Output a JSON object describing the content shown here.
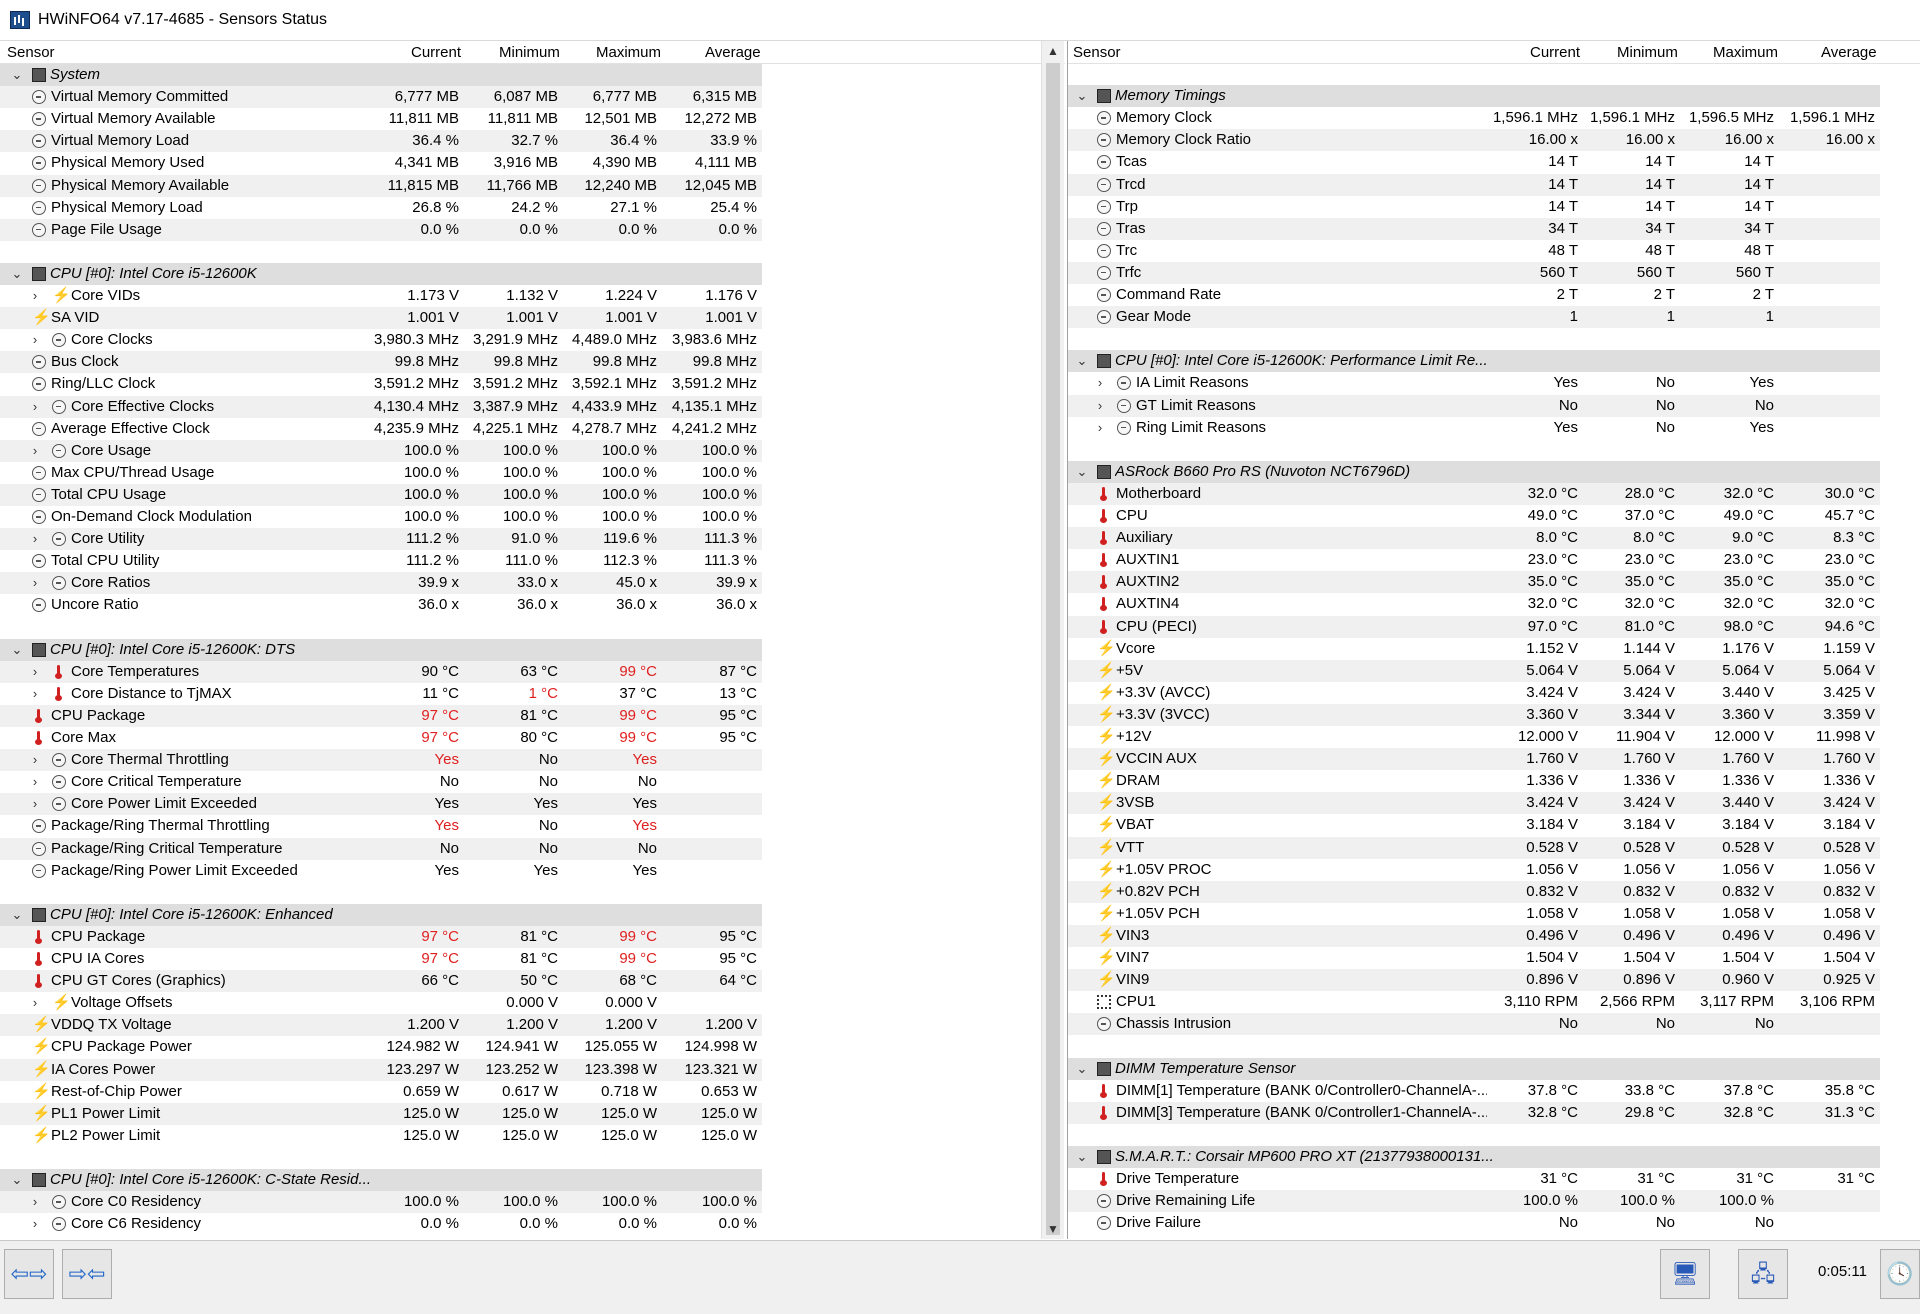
{
  "window": {
    "title": "HWiNFO64 v7.17-4685 - Sensors Status"
  },
  "columns": {
    "sensor": "Sensor",
    "current": "Current",
    "minimum": "Minimum",
    "maximum": "Maximum",
    "average": "Average"
  },
  "left_rows": [
    {
      "t": "g",
      "label": "System"
    },
    {
      "t": "r",
      "icon": "clock",
      "label": "Virtual Memory Committed",
      "cur": "6,777 MB",
      "min": "6,087 MB",
      "max": "6,777 MB",
      "avg": "6,315 MB"
    },
    {
      "t": "r",
      "icon": "clock",
      "label": "Virtual Memory Available",
      "cur": "11,811 MB",
      "min": "11,811 MB",
      "max": "12,501 MB",
      "avg": "12,272 MB"
    },
    {
      "t": "r",
      "icon": "clock",
      "label": "Virtual Memory Load",
      "cur": "36.4 %",
      "min": "32.7 %",
      "max": "36.4 %",
      "avg": "33.9 %"
    },
    {
      "t": "r",
      "icon": "clock",
      "label": "Physical Memory Used",
      "cur": "4,341 MB",
      "min": "3,916 MB",
      "max": "4,390 MB",
      "avg": "4,111 MB"
    },
    {
      "t": "r",
      "icon": "clock",
      "label": "Physical Memory Available",
      "cur": "11,815 MB",
      "min": "11,766 MB",
      "max": "12,240 MB",
      "avg": "12,045 MB"
    },
    {
      "t": "r",
      "icon": "clock",
      "label": "Physical Memory Load",
      "cur": "26.8 %",
      "min": "24.2 %",
      "max": "27.1 %",
      "avg": "25.4 %"
    },
    {
      "t": "r",
      "icon": "clock",
      "label": "Page File Usage",
      "cur": "0.0 %",
      "min": "0.0 %",
      "max": "0.0 %",
      "avg": "0.0 %"
    },
    {
      "t": "b"
    },
    {
      "t": "g",
      "label": "CPU [#0]: Intel Core i5-12600K"
    },
    {
      "t": "r",
      "exp": true,
      "icon": "bolt",
      "label": "Core VIDs",
      "cur": "1.173 V",
      "min": "1.132 V",
      "max": "1.224 V",
      "avg": "1.176 V"
    },
    {
      "t": "r",
      "icon": "bolt",
      "label": "SA VID",
      "cur": "1.001 V",
      "min": "1.001 V",
      "max": "1.001 V",
      "avg": "1.001 V"
    },
    {
      "t": "r",
      "exp": true,
      "icon": "clock",
      "label": "Core Clocks",
      "cur": "3,980.3 MHz",
      "min": "3,291.9 MHz",
      "max": "4,489.0 MHz",
      "avg": "3,983.6 MHz"
    },
    {
      "t": "r",
      "icon": "clock",
      "label": "Bus Clock",
      "cur": "99.8 MHz",
      "min": "99.8 MHz",
      "max": "99.8 MHz",
      "avg": "99.8 MHz"
    },
    {
      "t": "r",
      "icon": "clock",
      "label": "Ring/LLC Clock",
      "cur": "3,591.2 MHz",
      "min": "3,591.2 MHz",
      "max": "3,592.1 MHz",
      "avg": "3,591.2 MHz"
    },
    {
      "t": "r",
      "exp": true,
      "icon": "clock",
      "label": "Core Effective Clocks",
      "cur": "4,130.4 MHz",
      "min": "3,387.9 MHz",
      "max": "4,433.9 MHz",
      "avg": "4,135.1 MHz"
    },
    {
      "t": "r",
      "icon": "clock",
      "label": "Average Effective Clock",
      "cur": "4,235.9 MHz",
      "min": "4,225.1 MHz",
      "max": "4,278.7 MHz",
      "avg": "4,241.2 MHz"
    },
    {
      "t": "r",
      "exp": true,
      "icon": "clock",
      "label": "Core Usage",
      "cur": "100.0 %",
      "min": "100.0 %",
      "max": "100.0 %",
      "avg": "100.0 %"
    },
    {
      "t": "r",
      "icon": "clock",
      "label": "Max CPU/Thread Usage",
      "cur": "100.0 %",
      "min": "100.0 %",
      "max": "100.0 %",
      "avg": "100.0 %"
    },
    {
      "t": "r",
      "icon": "clock",
      "label": "Total CPU Usage",
      "cur": "100.0 %",
      "min": "100.0 %",
      "max": "100.0 %",
      "avg": "100.0 %"
    },
    {
      "t": "r",
      "icon": "clock",
      "label": "On-Demand Clock Modulation",
      "cur": "100.0 %",
      "min": "100.0 %",
      "max": "100.0 %",
      "avg": "100.0 %"
    },
    {
      "t": "r",
      "exp": true,
      "icon": "clock",
      "label": "Core Utility",
      "cur": "111.2 %",
      "min": "91.0 %",
      "max": "119.6 %",
      "avg": "111.3 %"
    },
    {
      "t": "r",
      "icon": "clock",
      "label": "Total CPU Utility",
      "cur": "111.2 %",
      "min": "111.0 %",
      "max": "112.3 %",
      "avg": "111.3 %"
    },
    {
      "t": "r",
      "exp": true,
      "icon": "clock",
      "label": "Core Ratios",
      "cur": "39.9 x",
      "min": "33.0 x",
      "max": "45.0 x",
      "avg": "39.9 x"
    },
    {
      "t": "r",
      "icon": "clock",
      "label": "Uncore Ratio",
      "cur": "36.0 x",
      "min": "36.0 x",
      "max": "36.0 x",
      "avg": "36.0 x"
    },
    {
      "t": "b"
    },
    {
      "t": "g",
      "label": "CPU [#0]: Intel Core i5-12600K: DTS"
    },
    {
      "t": "r",
      "exp": true,
      "icon": "temp",
      "label": "Core Temperatures",
      "cur": "90 °C",
      "min": "63 °C",
      "max": "99 °C",
      "avg": "87 °C",
      "red": [
        "max"
      ]
    },
    {
      "t": "r",
      "exp": true,
      "icon": "temp",
      "label": "Core Distance to TjMAX",
      "cur": "11 °C",
      "min": "1 °C",
      "max": "37 °C",
      "avg": "13 °C",
      "red": [
        "min"
      ]
    },
    {
      "t": "r",
      "icon": "temp",
      "label": "CPU Package",
      "cur": "97 °C",
      "min": "81 °C",
      "max": "99 °C",
      "avg": "95 °C",
      "red": [
        "cur",
        "max"
      ]
    },
    {
      "t": "r",
      "icon": "temp",
      "label": "Core Max",
      "cur": "97 °C",
      "min": "80 °C",
      "max": "99 °C",
      "avg": "95 °C",
      "red": [
        "cur",
        "max"
      ]
    },
    {
      "t": "r",
      "exp": true,
      "icon": "clock",
      "label": "Core Thermal Throttling",
      "cur": "Yes",
      "min": "No",
      "max": "Yes",
      "avg": "",
      "red": [
        "cur",
        "max"
      ]
    },
    {
      "t": "r",
      "exp": true,
      "icon": "clock",
      "label": "Core Critical Temperature",
      "cur": "No",
      "min": "No",
      "max": "No",
      "avg": ""
    },
    {
      "t": "r",
      "exp": true,
      "icon": "clock",
      "label": "Core Power Limit Exceeded",
      "cur": "Yes",
      "min": "Yes",
      "max": "Yes",
      "avg": ""
    },
    {
      "t": "r",
      "icon": "clock",
      "label": "Package/Ring Thermal Throttling",
      "cur": "Yes",
      "min": "No",
      "max": "Yes",
      "avg": "",
      "red": [
        "cur",
        "max"
      ]
    },
    {
      "t": "r",
      "icon": "clock",
      "label": "Package/Ring Critical Temperature",
      "cur": "No",
      "min": "No",
      "max": "No",
      "avg": ""
    },
    {
      "t": "r",
      "icon": "clock",
      "label": "Package/Ring Power Limit Exceeded",
      "cur": "Yes",
      "min": "Yes",
      "max": "Yes",
      "avg": ""
    },
    {
      "t": "b"
    },
    {
      "t": "g",
      "label": "CPU [#0]: Intel Core i5-12600K: Enhanced"
    },
    {
      "t": "r",
      "icon": "temp",
      "label": "CPU Package",
      "cur": "97 °C",
      "min": "81 °C",
      "max": "99 °C",
      "avg": "95 °C",
      "red": [
        "cur",
        "max"
      ]
    },
    {
      "t": "r",
      "icon": "temp",
      "label": "CPU IA Cores",
      "cur": "97 °C",
      "min": "81 °C",
      "max": "99 °C",
      "avg": "95 °C",
      "red": [
        "cur",
        "max"
      ]
    },
    {
      "t": "r",
      "icon": "temp",
      "label": "CPU GT Cores (Graphics)",
      "cur": "66 °C",
      "min": "50 °C",
      "max": "68 °C",
      "avg": "64 °C"
    },
    {
      "t": "r",
      "exp": true,
      "icon": "bolt",
      "label": "Voltage Offsets",
      "cur": "",
      "min": "0.000 V",
      "max": "0.000 V",
      "avg": ""
    },
    {
      "t": "r",
      "icon": "bolt",
      "label": "VDDQ TX Voltage",
      "cur": "1.200 V",
      "min": "1.200 V",
      "max": "1.200 V",
      "avg": "1.200 V"
    },
    {
      "t": "r",
      "icon": "bolt",
      "label": "CPU Package Power",
      "cur": "124.982 W",
      "min": "124.941 W",
      "max": "125.055 W",
      "avg": "124.998 W"
    },
    {
      "t": "r",
      "icon": "bolt",
      "label": "IA Cores Power",
      "cur": "123.297 W",
      "min": "123.252 W",
      "max": "123.398 W",
      "avg": "123.321 W"
    },
    {
      "t": "r",
      "icon": "bolt",
      "label": "Rest-of-Chip Power",
      "cur": "0.659 W",
      "min": "0.617 W",
      "max": "0.718 W",
      "avg": "0.653 W"
    },
    {
      "t": "r",
      "icon": "bolt",
      "label": "PL1 Power Limit",
      "cur": "125.0 W",
      "min": "125.0 W",
      "max": "125.0 W",
      "avg": "125.0 W"
    },
    {
      "t": "r",
      "icon": "bolt",
      "label": "PL2 Power Limit",
      "cur": "125.0 W",
      "min": "125.0 W",
      "max": "125.0 W",
      "avg": "125.0 W"
    },
    {
      "t": "b"
    },
    {
      "t": "g",
      "label": "CPU [#0]: Intel Core i5-12600K: C-State Resid..."
    },
    {
      "t": "r",
      "exp": true,
      "icon": "clock",
      "label": "Core C0 Residency",
      "cur": "100.0 %",
      "min": "100.0 %",
      "max": "100.0 %",
      "avg": "100.0 %"
    },
    {
      "t": "r",
      "exp": true,
      "icon": "clock",
      "label": "Core C6 Residency",
      "cur": "0.0 %",
      "min": "0.0 %",
      "max": "0.0 %",
      "avg": "0.0 %"
    }
  ],
  "right_rows": [
    {
      "t": "b"
    },
    {
      "t": "g",
      "label": "Memory Timings"
    },
    {
      "t": "r",
      "icon": "clock",
      "label": "Memory Clock",
      "cur": "1,596.1 MHz",
      "min": "1,596.1 MHz",
      "max": "1,596.5 MHz",
      "avg": "1,596.1 MHz"
    },
    {
      "t": "r",
      "icon": "clock",
      "label": "Memory Clock Ratio",
      "cur": "16.00 x",
      "min": "16.00 x",
      "max": "16.00 x",
      "avg": "16.00 x"
    },
    {
      "t": "r",
      "icon": "clock",
      "label": "Tcas",
      "cur": "14 T",
      "min": "14 T",
      "max": "14 T",
      "avg": ""
    },
    {
      "t": "r",
      "icon": "clock",
      "label": "Trcd",
      "cur": "14 T",
      "min": "14 T",
      "max": "14 T",
      "avg": ""
    },
    {
      "t": "r",
      "icon": "clock",
      "label": "Trp",
      "cur": "14 T",
      "min": "14 T",
      "max": "14 T",
      "avg": ""
    },
    {
      "t": "r",
      "icon": "clock",
      "label": "Tras",
      "cur": "34 T",
      "min": "34 T",
      "max": "34 T",
      "avg": ""
    },
    {
      "t": "r",
      "icon": "clock",
      "label": "Trc",
      "cur": "48 T",
      "min": "48 T",
      "max": "48 T",
      "avg": ""
    },
    {
      "t": "r",
      "icon": "clock",
      "label": "Trfc",
      "cur": "560 T",
      "min": "560 T",
      "max": "560 T",
      "avg": ""
    },
    {
      "t": "r",
      "icon": "clock",
      "label": "Command Rate",
      "cur": "2 T",
      "min": "2 T",
      "max": "2 T",
      "avg": ""
    },
    {
      "t": "r",
      "icon": "clock",
      "label": "Gear Mode",
      "cur": "1",
      "min": "1",
      "max": "1",
      "avg": ""
    },
    {
      "t": "b"
    },
    {
      "t": "g",
      "label": "CPU [#0]: Intel Core i5-12600K: Performance Limit Re..."
    },
    {
      "t": "r",
      "exp": true,
      "icon": "clock",
      "label": "IA Limit Reasons",
      "cur": "Yes",
      "min": "No",
      "max": "Yes",
      "avg": ""
    },
    {
      "t": "r",
      "exp": true,
      "icon": "clock",
      "label": "GT Limit Reasons",
      "cur": "No",
      "min": "No",
      "max": "No",
      "avg": ""
    },
    {
      "t": "r",
      "exp": true,
      "icon": "clock",
      "label": "Ring Limit Reasons",
      "cur": "Yes",
      "min": "No",
      "max": "Yes",
      "avg": ""
    },
    {
      "t": "b"
    },
    {
      "t": "g",
      "label": "ASRock B660 Pro RS (Nuvoton NCT6796D)"
    },
    {
      "t": "r",
      "icon": "temp",
      "label": "Motherboard",
      "cur": "32.0 °C",
      "min": "28.0 °C",
      "max": "32.0 °C",
      "avg": "30.0 °C"
    },
    {
      "t": "r",
      "icon": "temp",
      "label": "CPU",
      "cur": "49.0 °C",
      "min": "37.0 °C",
      "max": "49.0 °C",
      "avg": "45.7 °C"
    },
    {
      "t": "r",
      "icon": "temp",
      "label": "Auxiliary",
      "cur": "8.0 °C",
      "min": "8.0 °C",
      "max": "9.0 °C",
      "avg": "8.3 °C"
    },
    {
      "t": "r",
      "icon": "temp",
      "label": "AUXTIN1",
      "cur": "23.0 °C",
      "min": "23.0 °C",
      "max": "23.0 °C",
      "avg": "23.0 °C"
    },
    {
      "t": "r",
      "icon": "temp",
      "label": "AUXTIN2",
      "cur": "35.0 °C",
      "min": "35.0 °C",
      "max": "35.0 °C",
      "avg": "35.0 °C"
    },
    {
      "t": "r",
      "icon": "temp",
      "label": "AUXTIN4",
      "cur": "32.0 °C",
      "min": "32.0 °C",
      "max": "32.0 °C",
      "avg": "32.0 °C"
    },
    {
      "t": "r",
      "icon": "temp",
      "label": "CPU (PECI)",
      "cur": "97.0 °C",
      "min": "81.0 °C",
      "max": "98.0 °C",
      "avg": "94.6 °C"
    },
    {
      "t": "r",
      "icon": "bolt",
      "label": "Vcore",
      "cur": "1.152 V",
      "min": "1.144 V",
      "max": "1.176 V",
      "avg": "1.159 V"
    },
    {
      "t": "r",
      "icon": "bolt",
      "label": "+5V",
      "cur": "5.064 V",
      "min": "5.064 V",
      "max": "5.064 V",
      "avg": "5.064 V"
    },
    {
      "t": "r",
      "icon": "bolt",
      "label": "+3.3V (AVCC)",
      "cur": "3.424 V",
      "min": "3.424 V",
      "max": "3.440 V",
      "avg": "3.425 V"
    },
    {
      "t": "r",
      "icon": "bolt",
      "label": "+3.3V (3VCC)",
      "cur": "3.360 V",
      "min": "3.344 V",
      "max": "3.360 V",
      "avg": "3.359 V"
    },
    {
      "t": "r",
      "icon": "bolt",
      "label": "+12V",
      "cur": "12.000 V",
      "min": "11.904 V",
      "max": "12.000 V",
      "avg": "11.998 V"
    },
    {
      "t": "r",
      "icon": "bolt",
      "label": "VCCIN AUX",
      "cur": "1.760 V",
      "min": "1.760 V",
      "max": "1.760 V",
      "avg": "1.760 V"
    },
    {
      "t": "r",
      "icon": "bolt",
      "label": "DRAM",
      "cur": "1.336 V",
      "min": "1.336 V",
      "max": "1.336 V",
      "avg": "1.336 V"
    },
    {
      "t": "r",
      "icon": "bolt",
      "label": "3VSB",
      "cur": "3.424 V",
      "min": "3.424 V",
      "max": "3.440 V",
      "avg": "3.424 V"
    },
    {
      "t": "r",
      "icon": "bolt",
      "label": "VBAT",
      "cur": "3.184 V",
      "min": "3.184 V",
      "max": "3.184 V",
      "avg": "3.184 V"
    },
    {
      "t": "r",
      "icon": "bolt",
      "label": "VTT",
      "cur": "0.528 V",
      "min": "0.528 V",
      "max": "0.528 V",
      "avg": "0.528 V"
    },
    {
      "t": "r",
      "icon": "bolt",
      "label": "+1.05V PROC",
      "cur": "1.056 V",
      "min": "1.056 V",
      "max": "1.056 V",
      "avg": "1.056 V"
    },
    {
      "t": "r",
      "icon": "bolt",
      "label": "+0.82V PCH",
      "cur": "0.832 V",
      "min": "0.832 V",
      "max": "0.832 V",
      "avg": "0.832 V"
    },
    {
      "t": "r",
      "icon": "bolt",
      "label": "+1.05V PCH",
      "cur": "1.058 V",
      "min": "1.058 V",
      "max": "1.058 V",
      "avg": "1.058 V"
    },
    {
      "t": "r",
      "icon": "bolt",
      "label": "VIN3",
      "cur": "0.496 V",
      "min": "0.496 V",
      "max": "0.496 V",
      "avg": "0.496 V"
    },
    {
      "t": "r",
      "icon": "bolt",
      "label": "VIN7",
      "cur": "1.504 V",
      "min": "1.504 V",
      "max": "1.504 V",
      "avg": "1.504 V"
    },
    {
      "t": "r",
      "icon": "bolt",
      "label": "VIN9",
      "cur": "0.896 V",
      "min": "0.896 V",
      "max": "0.960 V",
      "avg": "0.925 V"
    },
    {
      "t": "r",
      "icon": "fan",
      "label": "CPU1",
      "cur": "3,110 RPM",
      "min": "2,566 RPM",
      "max": "3,117 RPM",
      "avg": "3,106 RPM"
    },
    {
      "t": "r",
      "icon": "clock",
      "label": "Chassis Intrusion",
      "cur": "No",
      "min": "No",
      "max": "No",
      "avg": ""
    },
    {
      "t": "b"
    },
    {
      "t": "g",
      "label": "DIMM Temperature Sensor"
    },
    {
      "t": "r",
      "icon": "temp",
      "label": "DIMM[1] Temperature (BANK 0/Controller0-ChannelA-...",
      "cur": "37.8 °C",
      "min": "33.8 °C",
      "max": "37.8 °C",
      "avg": "35.8 °C"
    },
    {
      "t": "r",
      "icon": "temp",
      "label": "DIMM[3] Temperature (BANK 0/Controller1-ChannelA-...",
      "cur": "32.8 °C",
      "min": "29.8 °C",
      "max": "32.8 °C",
      "avg": "31.3 °C"
    },
    {
      "t": "b"
    },
    {
      "t": "g",
      "label": "S.M.A.R.T.: Corsair MP600 PRO XT (21377938000131..."
    },
    {
      "t": "r",
      "icon": "temp",
      "label": "Drive Temperature",
      "cur": "31 °C",
      "min": "31 °C",
      "max": "31 °C",
      "avg": "31 °C"
    },
    {
      "t": "r",
      "icon": "clock",
      "label": "Drive Remaining Life",
      "cur": "100.0 %",
      "min": "100.0 %",
      "max": "100.0 %",
      "avg": ""
    },
    {
      "t": "r",
      "icon": "clock",
      "label": "Drive Failure",
      "cur": "No",
      "min": "No",
      "max": "No",
      "avg": ""
    }
  ],
  "statusbar": {
    "nav_left_label": "⇦⇨",
    "nav_right_label": "⇨⇦",
    "timer": "0:05:11"
  },
  "colors": {
    "alarm_red": "#e02020",
    "group_band": "#dedede",
    "alt_band": "#f0f0f0"
  }
}
